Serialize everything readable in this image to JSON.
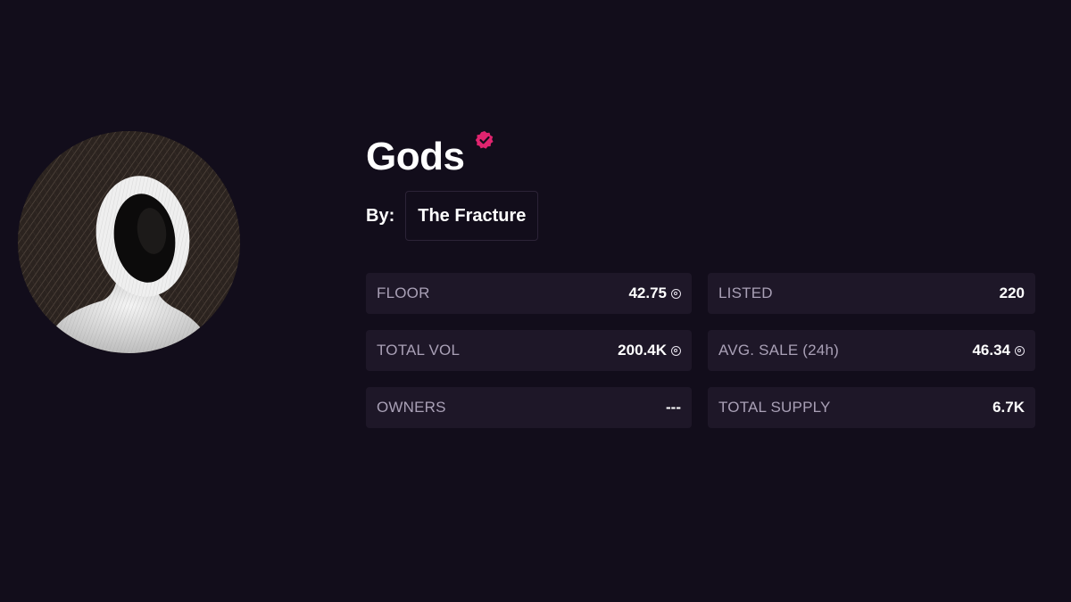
{
  "collection": {
    "name": "Gods",
    "verified": true,
    "by_label": "By:",
    "creator": "The Fracture"
  },
  "stats": [
    {
      "label": "FLOOR",
      "value": "42.75",
      "currency_icon": "sol-icon"
    },
    {
      "label": "LISTED",
      "value": "220",
      "currency_icon": null
    },
    {
      "label": "TOTAL VOL",
      "value": "200.4K",
      "currency_icon": "sol-icon"
    },
    {
      "label": "AVG. SALE (24h)",
      "value": "46.34",
      "currency_icon": "sol-icon"
    },
    {
      "label": "OWNERS",
      "value": "---",
      "currency_icon": null
    },
    {
      "label": "TOTAL SUPPLY",
      "value": "6.7K",
      "currency_icon": null
    }
  ],
  "colors": {
    "background": "#120d1b",
    "card": "#1e1728",
    "accent_verified": "#e0246f",
    "label": "#a9a0b6",
    "value": "#ffffff"
  },
  "icons": {
    "verified": "verified-badge-icon",
    "currency": "sol-icon"
  }
}
